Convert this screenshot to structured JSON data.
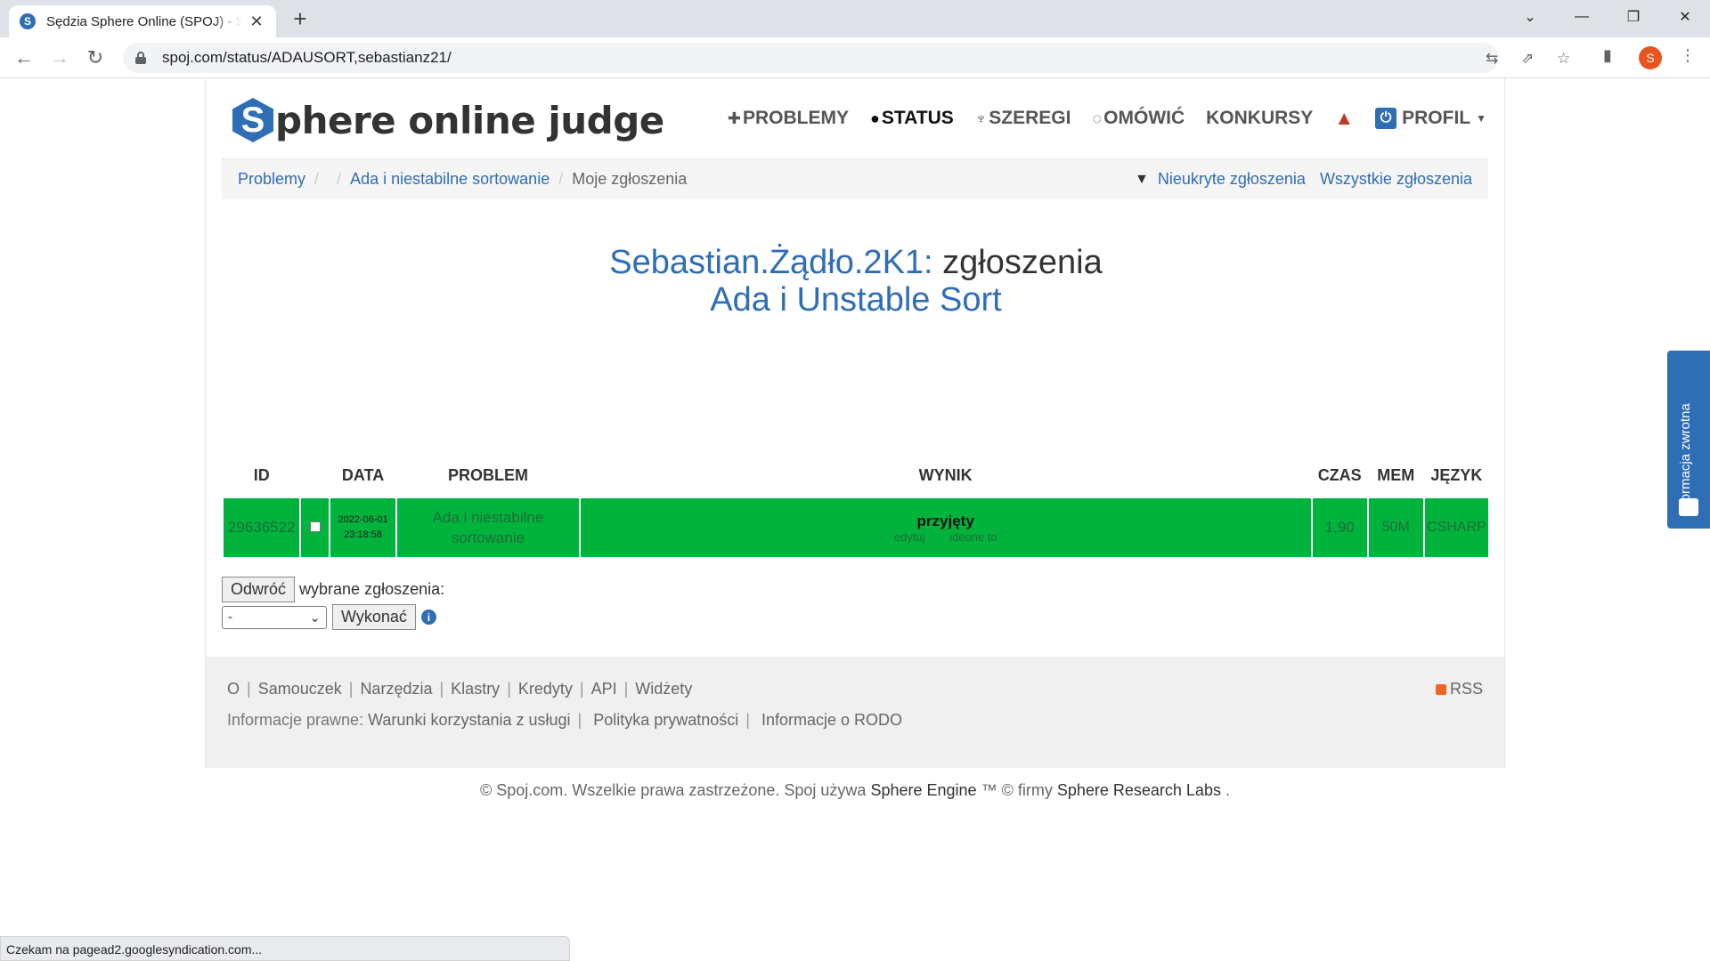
{
  "browser": {
    "tab_title": "Sędzia Sphere Online (SPOJ) - Status",
    "favicon_letter": "S",
    "url": "spoj.com/status/ADAUSORT,sebastianz21/",
    "avatar_letter": "S",
    "status_text": "Czekam na pagead2.googlesyndication.com..."
  },
  "site": {
    "logo_letter": "S",
    "logo_text": "phere online judge",
    "nav": {
      "problems": "PROBLEMY",
      "status": "STATUS",
      "ranks": "SZEREGI",
      "discuss": "OMÓWIĆ",
      "contests": "KONKURSY",
      "profile": "PROFIL"
    }
  },
  "breadcrumb": {
    "problems": "Problemy",
    "problem_name": "Ada i niestabilne sortowanie",
    "current": "Moje zgłoszenia",
    "unhidden": "Nieukryte zgłoszenia",
    "all": "Wszystkie zgłoszenia"
  },
  "heading": {
    "user": "Sebastian.Żądło.2K1:",
    "suffix": "zgłoszenia",
    "problem": "Ada i Unstable Sort"
  },
  "table": {
    "headers": {
      "id": "ID",
      "date": "DATA",
      "problem": "PROBLEM",
      "result": "WYNIK",
      "time": "CZAS",
      "mem": "MEM",
      "lang": "JĘZYK"
    },
    "rows": [
      {
        "id": "29636522",
        "date": "2022-06-01",
        "time_of_day": "23:18:58",
        "problem": "Ada i niestabilne sortowanie",
        "result": "przyjęty",
        "edit": "edytuj",
        "ideone": "ideone to",
        "time": "1,90",
        "mem": "50M",
        "lang": "CSHARP",
        "status_color": "#00b33c"
      }
    ]
  },
  "actions": {
    "invert": "Odwróć",
    "selected_label": "wybrane zgłoszenia:",
    "select_value": "-",
    "execute": "Wykonać"
  },
  "footer": {
    "links": [
      "O",
      "Samouczek",
      "Narzędzia",
      "Klastry",
      "Kredyty",
      "API",
      "Widżety"
    ],
    "rss": "RSS",
    "legal_label": "Informacje prawne:",
    "legal_links": [
      "Warunki korzystania z usługi",
      "Polityka prywatności",
      "Informacje o RODO"
    ],
    "copyright_pre": "© Spoj.com. Wszelkie prawa zastrzeżone. Spoj używa",
    "engine": "Sphere Engine",
    "copyright_mid": "™ © firmy",
    "labs": "Sphere Research Labs",
    "copyright_end": "."
  },
  "feedback": {
    "label": "Informacja zwrotna"
  },
  "colors": {
    "accent": "#2f6db5",
    "accepted": "#00b33c",
    "warning": "#c0392b"
  }
}
